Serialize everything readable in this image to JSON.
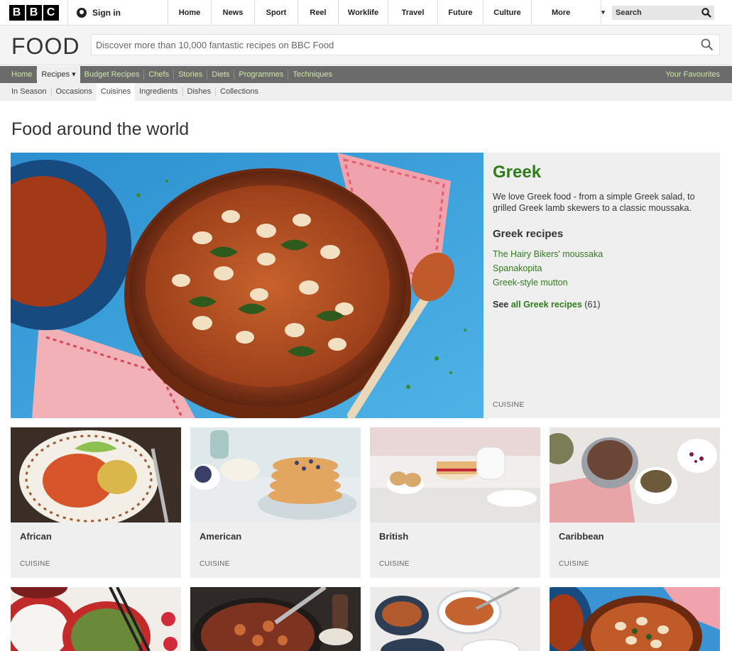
{
  "topbar": {
    "logo": [
      "B",
      "B",
      "C"
    ],
    "sign_in": "Sign in",
    "nav": [
      "Home",
      "News",
      "Sport",
      "Reel",
      "Worklife",
      "Travel",
      "Future",
      "Culture"
    ],
    "more": "More",
    "search_placeholder": "Search"
  },
  "food_header": {
    "logo": "FOOD",
    "search_placeholder": "Discover more than 10,000 fantastic recipes on BBC Food"
  },
  "main_nav": {
    "items": [
      "Home",
      "Recipes ▾",
      "Budget Recipes",
      "Chefs",
      "Stories",
      "Diets",
      "Programmes",
      "Techniques"
    ],
    "active_index": 1,
    "favourites": "Your Favourites"
  },
  "sub_nav": {
    "items": [
      "In Season",
      "Occasions",
      "Cuisines",
      "Ingredients",
      "Dishes",
      "Collections"
    ],
    "active_index": 2
  },
  "page": {
    "title": "Food around the world"
  },
  "featured": {
    "name": "Greek",
    "description": "We love Greek food - from a simple Greek salad, to grilled Greek lamb skewers to a classic moussaka.",
    "recipes_heading": "Greek recipes",
    "recipes": [
      "The Hairy Bikers' moussaka",
      "Spanakopita",
      "Greek-style mutton"
    ],
    "see_prefix": "See ",
    "see_link": "all Greek recipes",
    "see_count": "(61)",
    "tag": "CUISINE"
  },
  "cuisines": [
    {
      "name": "African",
      "tag": "CUISINE"
    },
    {
      "name": "American",
      "tag": "CUISINE"
    },
    {
      "name": "British",
      "tag": "CUISINE"
    },
    {
      "name": "Caribbean",
      "tag": "CUISINE"
    }
  ],
  "colors": {
    "accent_green": "#2e7d1a",
    "nav_green": "#cfe5a7",
    "nav_bg": "#6b6b6b"
  }
}
